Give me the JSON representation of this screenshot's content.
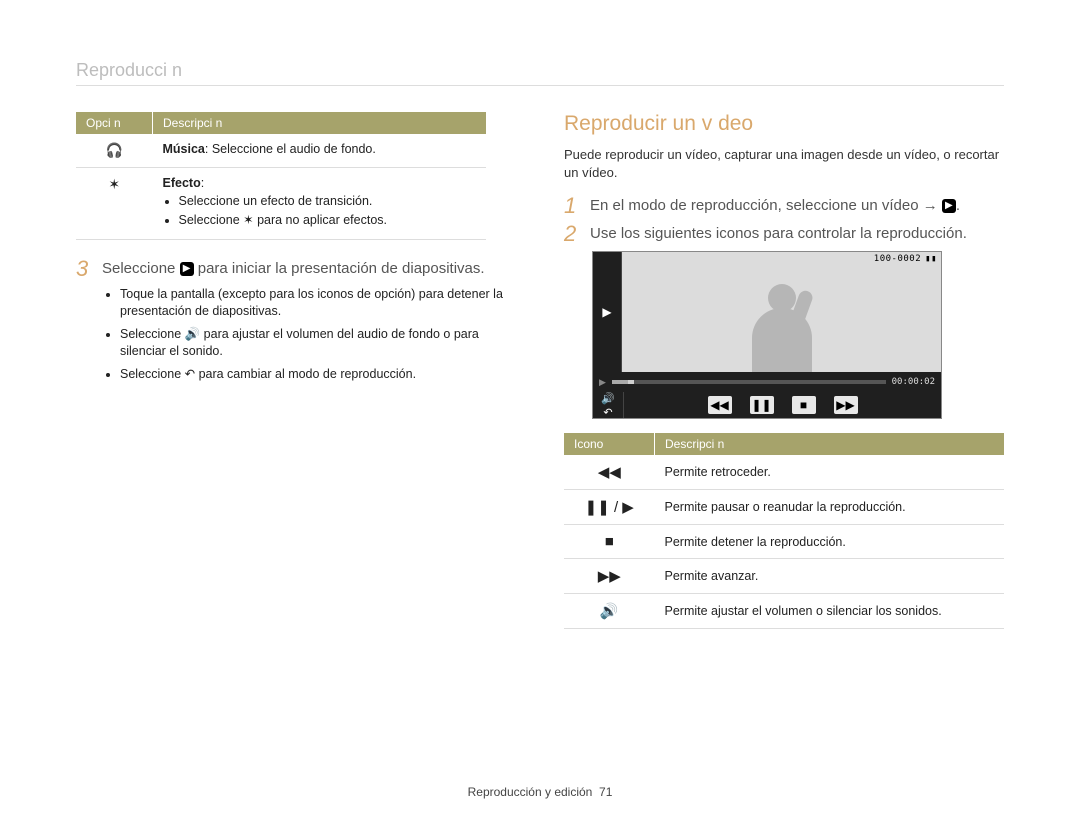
{
  "page_title": "Reproducci n",
  "left": {
    "table": {
      "headers": {
        "opcion": "Opci n",
        "descripcion": "Descripci n"
      },
      "rows": [
        {
          "icon": "headphones-off-icon",
          "icon_glyph": "🎧",
          "desc_label": "Música",
          "desc_text": ": Seleccione el audio de fondo."
        },
        {
          "icon": "effect-off-icon",
          "icon_glyph": "✶",
          "desc_label": "Efecto",
          "bullets": [
            "Seleccione un efecto de transición.",
            "Seleccione ✶ para no aplicar efectos."
          ]
        }
      ]
    },
    "step": {
      "num": "3",
      "text_before": "Seleccione ",
      "text_after": " para iniciar la presentación de diapositivas.",
      "bullets": [
        "Toque la pantalla (excepto para los iconos de opción) para detener la presentación de diapositivas.",
        "Seleccione 🔊 para ajustar el volumen del audio de fondo o para silenciar el sonido.",
        "Seleccione ↶ para cambiar al modo de reproducción."
      ]
    }
  },
  "right": {
    "section_title": "Reproducir un v deo",
    "intro": "Puede reproducir un vídeo, capturar una imagen desde un vídeo, o recortar un vídeo.",
    "steps": [
      {
        "num": "1",
        "before": "En el modo de reproducción, seleccione un vídeo → ",
        "after": "."
      },
      {
        "num": "2",
        "before": "Use los siguientes iconos para controlar la reproducción.",
        "after": ""
      }
    ],
    "player": {
      "meta_code": "100-0002",
      "time": "00:00:02"
    },
    "icon_table": {
      "headers": {
        "icono": "Icono",
        "descripcion": "Descripci n"
      },
      "rows": [
        {
          "glyph": "◀◀",
          "desc": "Permite retroceder."
        },
        {
          "glyph": "❚❚ / ▶",
          "desc": "Permite pausar o reanudar la reproducción."
        },
        {
          "glyph": "■",
          "desc": "Permite detener la reproducción."
        },
        {
          "glyph": "▶▶",
          "desc": "Permite avanzar."
        },
        {
          "glyph": "🔊",
          "desc": "Permite ajustar el volumen o silenciar los sonidos."
        }
      ]
    }
  },
  "footer": {
    "section": "Reproducción y edición",
    "page": "71"
  }
}
